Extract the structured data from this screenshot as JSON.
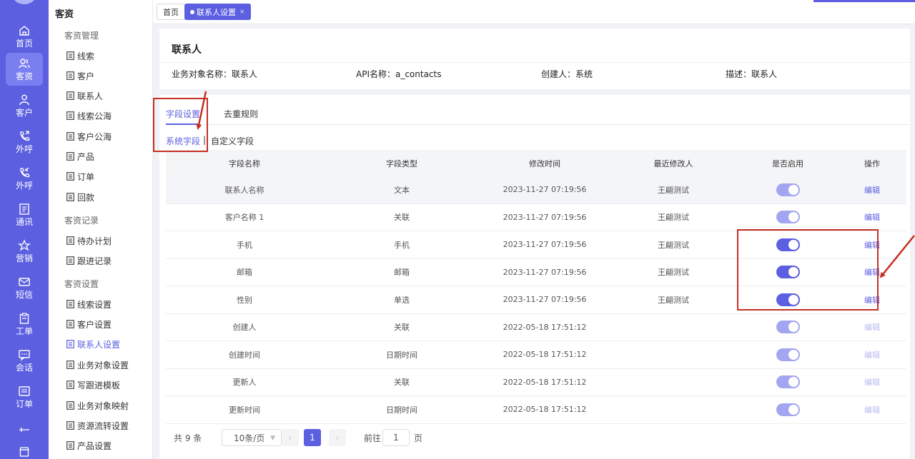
{
  "rail": {
    "items": [
      {
        "label": "首页",
        "icon": "home-icon"
      },
      {
        "label": "客资",
        "icon": "users-icon"
      },
      {
        "label": "客户",
        "icon": "user-icon"
      },
      {
        "label": "外呼",
        "icon": "phone-out-icon"
      },
      {
        "label": "外呼",
        "icon": "phone-in-icon"
      },
      {
        "label": "通讯",
        "icon": "contacts-icon"
      },
      {
        "label": "营销",
        "icon": "marketing-icon"
      },
      {
        "label": "短信",
        "icon": "sms-icon"
      },
      {
        "label": "工单",
        "icon": "clipboard-icon"
      },
      {
        "label": "会话",
        "icon": "chat-icon"
      },
      {
        "label": "订单",
        "icon": "order-icon"
      },
      {
        "label": "",
        "icon": "sliders-icon"
      },
      {
        "label": "",
        "icon": "shop-icon"
      }
    ],
    "active_index": 1
  },
  "submenu": {
    "title": "客资",
    "group1": "客资管理",
    "group2": "客资记录",
    "group3": "客资设置",
    "items": [
      "线索",
      "客户",
      "联系人",
      "线索公海",
      "客户公海",
      "产品",
      "订单",
      "回款",
      "待办计划",
      "跟进记录",
      "线索设置",
      "客户设置",
      "联系人设置",
      "业务对象设置",
      "写跟进模板",
      "业务对象映射",
      "资源流转设置",
      "产品设置"
    ],
    "active_item": "联系人设置"
  },
  "tabs": {
    "home": "首页",
    "active": "联系人设置",
    "close": "×"
  },
  "info": {
    "title": "联系人",
    "object_name": "业务对象名称：联系人",
    "api_name": "API名称：a_contacts",
    "creator": "创建人：系统",
    "description": "描述：联系人"
  },
  "field_tabs": {
    "settings": "字段设置",
    "dedup": "去重规则",
    "system": "系统字段",
    "separator": "|",
    "custom": "自定义字段"
  },
  "table": {
    "headers": [
      "字段名称",
      "字段类型",
      "修改时间",
      "最近修改人",
      "是否启用",
      "操作"
    ],
    "rows": [
      {
        "name": "联系人名称",
        "type": "文本",
        "time": "2023-11-27 07:19:56",
        "modifier": "王翩测试",
        "enabled": "dim",
        "action": "编辑",
        "editable": true
      },
      {
        "name": "客户名称 1",
        "type": "关联",
        "time": "2023-11-27 07:19:56",
        "modifier": "王翩测试",
        "enabled": "dim",
        "action": "编辑",
        "editable": true
      },
      {
        "name": "手机",
        "type": "手机",
        "time": "2023-11-27 07:19:56",
        "modifier": "王翩测试",
        "enabled": "on",
        "action": "编辑",
        "editable": true
      },
      {
        "name": "邮箱",
        "type": "邮箱",
        "time": "2023-11-27 07:19:56",
        "modifier": "王翩测试",
        "enabled": "on",
        "action": "编辑",
        "editable": true
      },
      {
        "name": "性别",
        "type": "单选",
        "time": "2023-11-27 07:19:56",
        "modifier": "王翩测试",
        "enabled": "on",
        "action": "编辑",
        "editable": true
      },
      {
        "name": "创建人",
        "type": "关联",
        "time": "2022-05-18 17:51:12",
        "modifier": "",
        "enabled": "dim",
        "action": "编辑",
        "editable": false
      },
      {
        "name": "创建时间",
        "type": "日期时间",
        "time": "2022-05-18 17:51:12",
        "modifier": "",
        "enabled": "dim",
        "action": "编辑",
        "editable": false
      },
      {
        "name": "更新人",
        "type": "关联",
        "time": "2022-05-18 17:51:12",
        "modifier": "",
        "enabled": "dim",
        "action": "编辑",
        "editable": false
      },
      {
        "name": "更新时间",
        "type": "日期时间",
        "time": "2022-05-18 17:51:12",
        "modifier": "",
        "enabled": "dim",
        "action": "编辑",
        "editable": false
      }
    ]
  },
  "pagination": {
    "total": "共 9 条",
    "page_size": "10条/页",
    "current": "1",
    "goto_label": "前往",
    "goto_value": "1",
    "page_suffix": "页",
    "prev": "‹",
    "next": "›"
  },
  "colors": {
    "accent": "#5b5fe0",
    "annotation": "#c62f24"
  }
}
